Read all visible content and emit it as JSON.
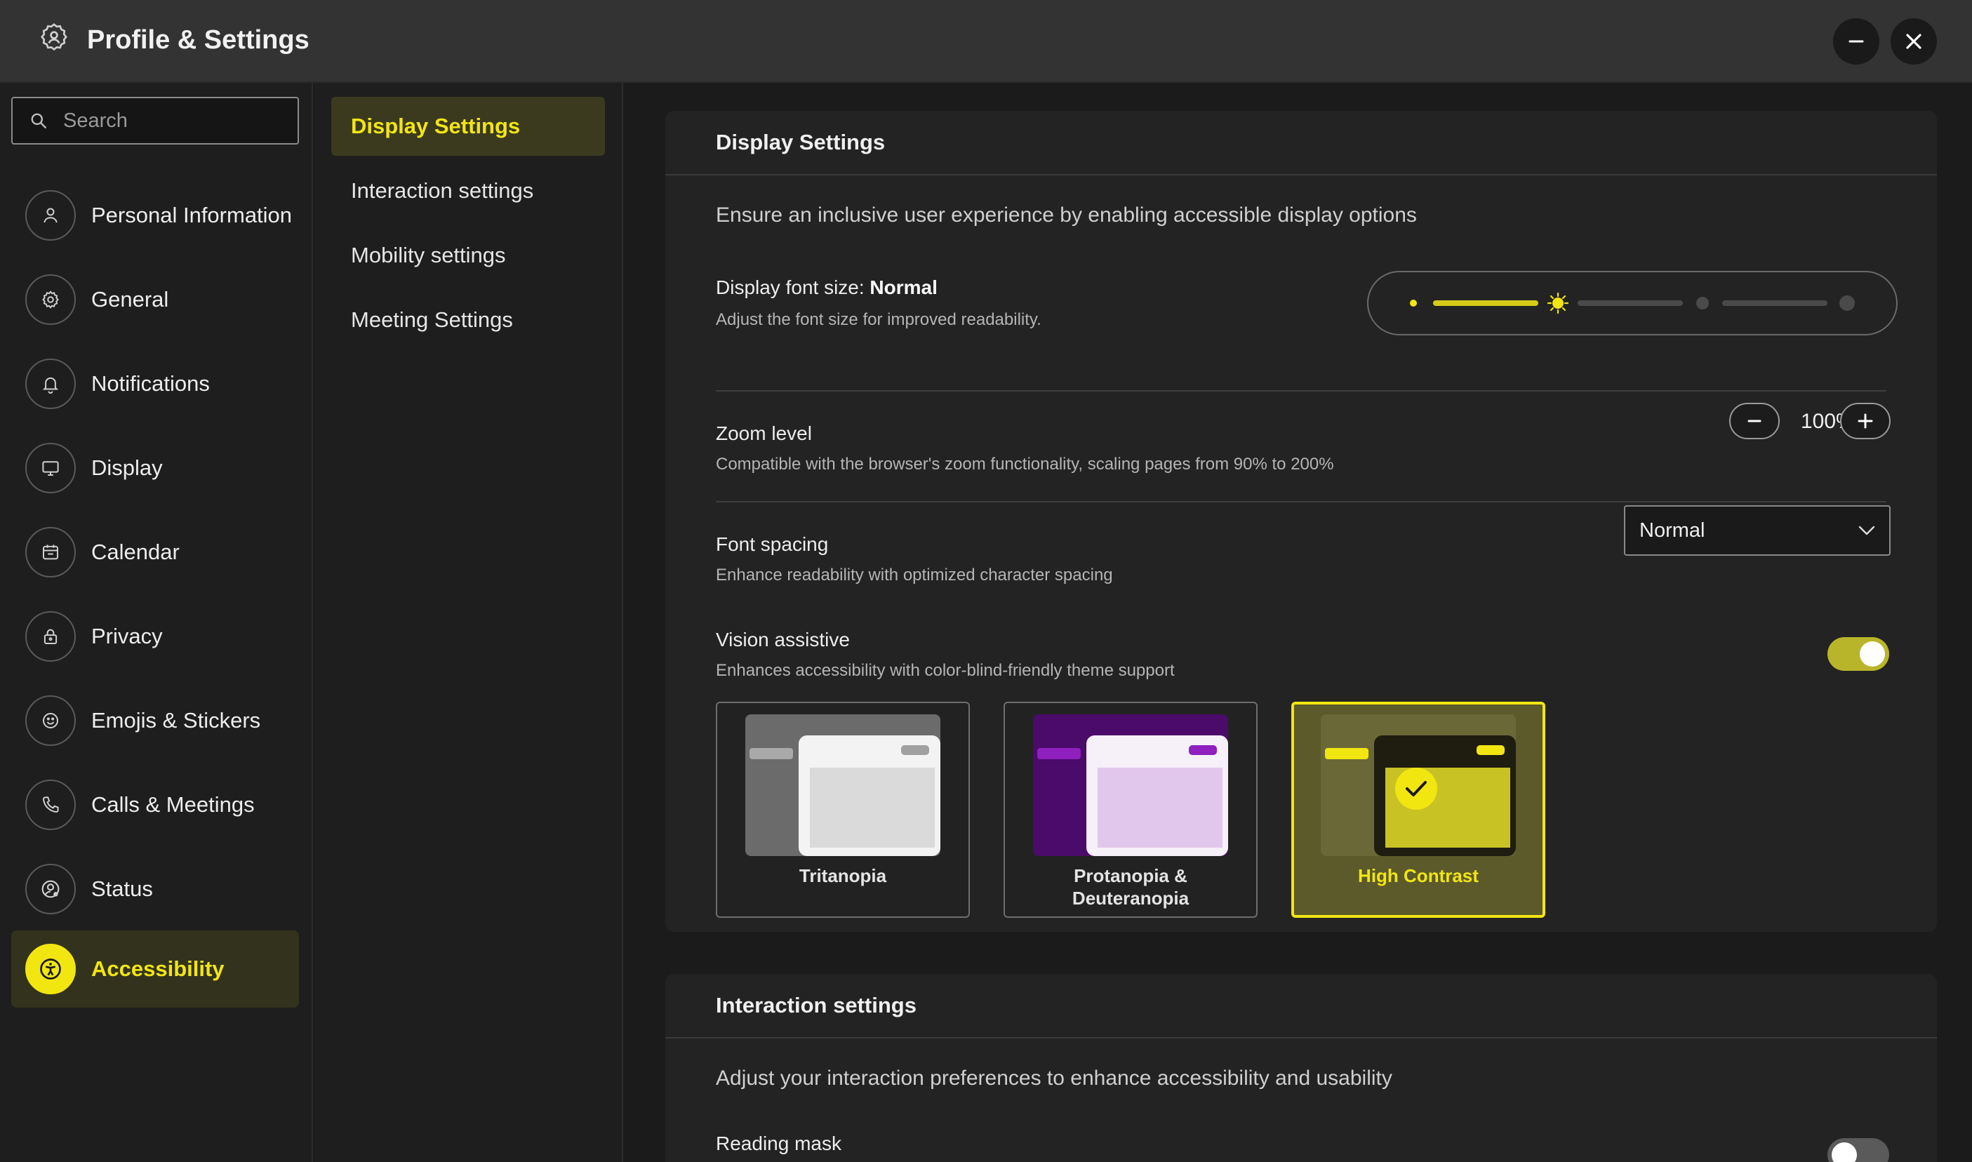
{
  "window": {
    "title": "Profile & Settings",
    "app_icon": "gear-user-icon",
    "minimize_icon": "minus-icon",
    "close_icon": "close-icon"
  },
  "colors": {
    "accent": "#f2e611",
    "background": "#1b1b1b",
    "panel": "#232323"
  },
  "search": {
    "placeholder": "Search",
    "value": ""
  },
  "sidebar": {
    "items": [
      {
        "label": "Personal Information",
        "icon": "person-icon"
      },
      {
        "label": "General",
        "icon": "gear-icon"
      },
      {
        "label": "Notifications",
        "icon": "bell-icon"
      },
      {
        "label": "Display",
        "icon": "monitor-icon"
      },
      {
        "label": "Calendar",
        "icon": "calendar-icon"
      },
      {
        "label": "Privacy",
        "icon": "lock-icon"
      },
      {
        "label": "Emojis & Stickers",
        "icon": "smiley-icon"
      },
      {
        "label": "Calls & Meetings",
        "icon": "phone-icon"
      },
      {
        "label": "Status",
        "icon": "user-status-icon"
      },
      {
        "label": "Accessibility",
        "icon": "accessibility-icon",
        "active": true
      }
    ]
  },
  "subnav": {
    "items": [
      {
        "label": "Display Settings",
        "active": true
      },
      {
        "label": "Interaction settings"
      },
      {
        "label": "Mobility settings"
      },
      {
        "label": "Meeting Settings"
      }
    ]
  },
  "display_settings": {
    "header": "Display Settings",
    "description": "Ensure an inclusive user experience by enabling accessible display options",
    "font_size": {
      "title_prefix": "Display font size:",
      "title_value": "Normal",
      "subtitle": "Adjust the font size for improved readability.",
      "level_index": 1,
      "levels": 4
    },
    "zoom": {
      "title": "Zoom level",
      "subtitle": "Compatible with the browser's zoom functionality, scaling pages from 90% to 200%",
      "value": "100%",
      "minus_icon": "minus-icon",
      "plus_icon": "plus-icon"
    },
    "font_spacing": {
      "title": "Font spacing",
      "subtitle": "Enhance readability with optimized character spacing",
      "selected": "Normal"
    },
    "vision_assistive": {
      "title": "Vision assistive",
      "subtitle": "Enhances accessibility with color-blind-friendly theme support",
      "enabled": true,
      "themes": [
        {
          "name": "Tritanopia"
        },
        {
          "name_line1": "Protanopia &",
          "name_line2": "Deuteranopia"
        },
        {
          "name": "High Contrast",
          "selected": true
        }
      ]
    }
  },
  "interaction_settings": {
    "header": "Interaction settings",
    "description": "Adjust your interaction preferences to enhance accessibility and usability",
    "reading_mask": {
      "title": "Reading mask",
      "enabled": false
    }
  }
}
